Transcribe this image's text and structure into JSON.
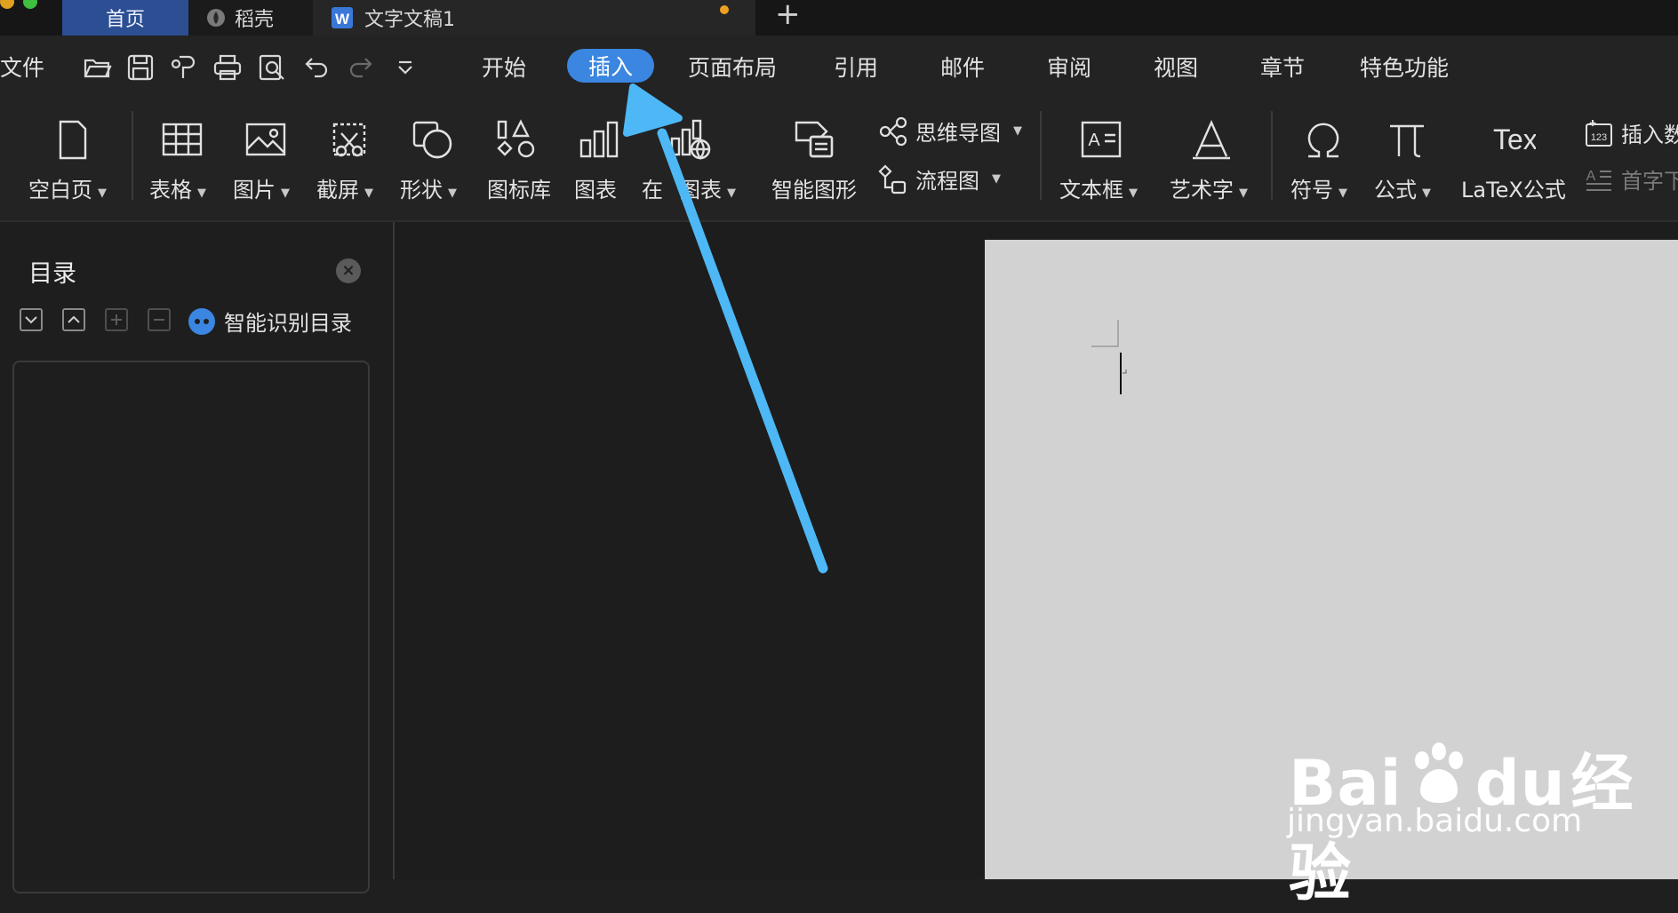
{
  "tabs": {
    "home": "首页",
    "daoke": "稻壳",
    "document": "文字文稿1",
    "new_tab": "+"
  },
  "menu": {
    "file": "文件",
    "items": [
      "开始",
      "插入",
      "页面布局",
      "引用",
      "邮件",
      "审阅",
      "视图",
      "章节",
      "特色功能"
    ],
    "active": "插入"
  },
  "ribbon": {
    "blank_page": "空白页",
    "table": "表格",
    "picture": "图片",
    "screenshot": "截屏",
    "shape": "形状",
    "icon_library": "图标库",
    "chart": "图表",
    "online_chart_prefix": "在",
    "online_chart": "图表",
    "smart_art": "智能图形",
    "mind_map": "思维导图",
    "flowchart": "流程图",
    "text_box": "文本框",
    "word_art": "艺术字",
    "symbol": "符号",
    "formula": "公式",
    "latex": "LaTeX公式",
    "insert_number": "插入数",
    "drop_cap": "首字下"
  },
  "toc_panel": {
    "title": "目录",
    "smart_toc": "智能识别目录"
  },
  "watermark": {
    "brand": "Bai",
    "brand_suffix": "du",
    "cn": "经验",
    "url": "jingyan.baidu.com"
  },
  "colors": {
    "accent": "#3a86e0",
    "arrow": "#4db8f5",
    "home_tab": "#2c4f93",
    "unsaved_dot": "#f0a020"
  }
}
